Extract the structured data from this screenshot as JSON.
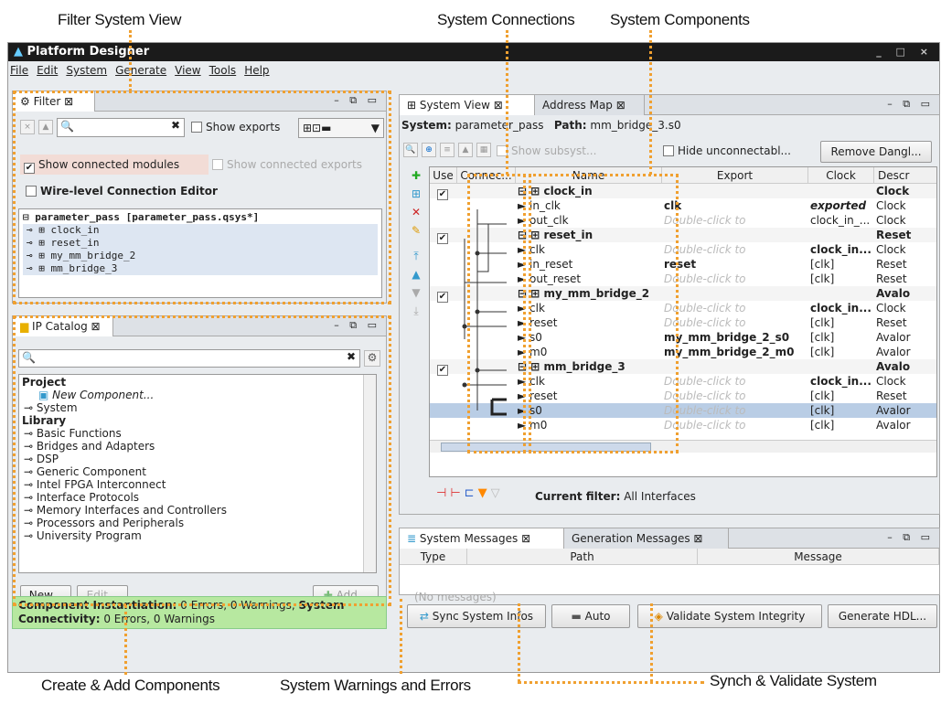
{
  "callouts": {
    "filter_view": "Filter System View",
    "system_connections": "System Connections",
    "system_components": "System Components",
    "create_add": "Create & Add Components",
    "warnings_errors": "System Warnings and Errors",
    "synch_validate": "Synch & Validate System"
  },
  "window": {
    "title": "Platform Designer",
    "controls": "_ □ ×"
  },
  "menu": [
    "File",
    "Edit",
    "System",
    "Generate",
    "View",
    "Tools",
    "Help"
  ],
  "filter_panel": {
    "tab": "Filter",
    "show_exports": "Show exports",
    "show_connected_modules": "Show connected modules",
    "show_connected_exports": "Show connected exports",
    "wire_level": "Wire-level Connection Editor",
    "tree_root": "parameter_pass [parameter_pass.qsys*]",
    "tree_items": [
      "clock_in",
      "reset_in",
      "my_mm_bridge_2",
      "mm_bridge_3"
    ]
  },
  "ip_catalog": {
    "tab": "IP Catalog",
    "project_label": "Project",
    "new_component": "New Component...",
    "system": "System",
    "library_label": "Library",
    "library_items": [
      "Basic Functions",
      "Bridges and Adapters",
      "DSP",
      "Generic Component",
      "Intel FPGA Interconnect",
      "Interface Protocols",
      "Memory Interfaces and Controllers",
      "Processors and Peripherals",
      "University Program"
    ],
    "new_button": "New...",
    "edit_button": "Edit...",
    "add_button": "Add..."
  },
  "system_view": {
    "tab": "System View",
    "tab2": "Address Map",
    "system_label": "System:",
    "system_name": "parameter_pass",
    "path_label": "Path:",
    "path_value": "mm_bridge_3.s0",
    "show_subsystems": "Show subsyst...",
    "hide_unconnectable": "Hide unconnectabl...",
    "remove_dangling": "Remove Dangl...",
    "columns": [
      "Use",
      "Connec...",
      "Name",
      "Export",
      "Clock",
      "Descr"
    ],
    "rows": [
      {
        "use": true,
        "name": "clock_in",
        "export": "",
        "clock": "",
        "desc": "Clock",
        "level": 0
      },
      {
        "name": "in_clk",
        "export": "clk",
        "export_bold": true,
        "clock": "exported",
        "clock_style": "italicbold",
        "desc": "Clock",
        "level": 1
      },
      {
        "name": "out_clk",
        "export": "Double-click to",
        "export_gray": true,
        "clock": "clock_in_...",
        "desc": "Clock",
        "level": 1
      },
      {
        "use": true,
        "name": "reset_in",
        "export": "",
        "clock": "",
        "desc": "Reset",
        "level": 0
      },
      {
        "name": "clk",
        "export": "Double-click to",
        "export_gray": true,
        "clock": "clock_in...",
        "clock_bold": true,
        "desc": "Clock",
        "level": 1
      },
      {
        "name": "in_reset",
        "export": "reset",
        "export_bold": true,
        "clock": "[clk]",
        "desc": "Reset",
        "level": 1
      },
      {
        "name": "out_reset",
        "export": "Double-click to",
        "export_gray": true,
        "clock": "[clk]",
        "desc": "Reset",
        "level": 1
      },
      {
        "use": true,
        "name": "my_mm_bridge_2",
        "export": "",
        "clock": "",
        "desc": "Avalo",
        "level": 0
      },
      {
        "name": "clk",
        "export": "Double-click to",
        "export_gray": true,
        "clock": "clock_in...",
        "clock_bold": true,
        "desc": "Clock",
        "level": 1
      },
      {
        "name": "reset",
        "export": "Double-click to",
        "export_gray": true,
        "clock": "[clk]",
        "desc": "Reset",
        "level": 1
      },
      {
        "name": "s0",
        "export": "my_mm_bridge_2_s0",
        "export_bold": true,
        "clock": "[clk]",
        "desc": "Avalor",
        "level": 1
      },
      {
        "name": "m0",
        "export": "my_mm_bridge_2_m0",
        "export_bold": true,
        "clock": "[clk]",
        "desc": "Avalor",
        "level": 1
      },
      {
        "use": true,
        "name": "mm_bridge_3",
        "export": "",
        "clock": "",
        "desc": "Avalo",
        "level": 0
      },
      {
        "name": "clk",
        "export": "Double-click to",
        "export_gray": true,
        "clock": "clock_in...",
        "clock_bold": true,
        "desc": "Clock",
        "level": 1
      },
      {
        "name": "reset",
        "export": "Double-click to",
        "export_gray": true,
        "clock": "[clk]",
        "desc": "Reset",
        "level": 1
      },
      {
        "name": "s0",
        "export": "Double-click to",
        "export_gray": true,
        "clock": "[clk]",
        "desc": "Avalor",
        "level": 1,
        "selected": true
      },
      {
        "name": "m0",
        "export": "Double-click to",
        "export_gray": true,
        "clock": "[clk]",
        "desc": "Avalor",
        "level": 1
      }
    ],
    "current_filter_label": "Current filter:",
    "current_filter_value": "All Interfaces"
  },
  "messages": {
    "tab": "System Messages",
    "tab2": "Generation Messages",
    "columns": [
      "Type",
      "Path",
      "Message"
    ],
    "empty": "(No messages)"
  },
  "status": {
    "line1_a": "Component Instantiation:",
    "line1_b": " 0 Errors, 0 Warnings, ",
    "line1_c": "System",
    "line2_a": "Connectivity:",
    "line2_b": " 0 Errors, 0 Warnings"
  },
  "bottom_buttons": {
    "sync": "Sync System Infos",
    "auto": "Auto",
    "validate": "Validate System Integrity",
    "generate": "Generate HDL..."
  },
  "colors": {
    "status_bg": "#b7e8a0",
    "callout_accent": "#f0a030",
    "selection": "#b9cde5",
    "titlebar": "#1b1b1b"
  }
}
